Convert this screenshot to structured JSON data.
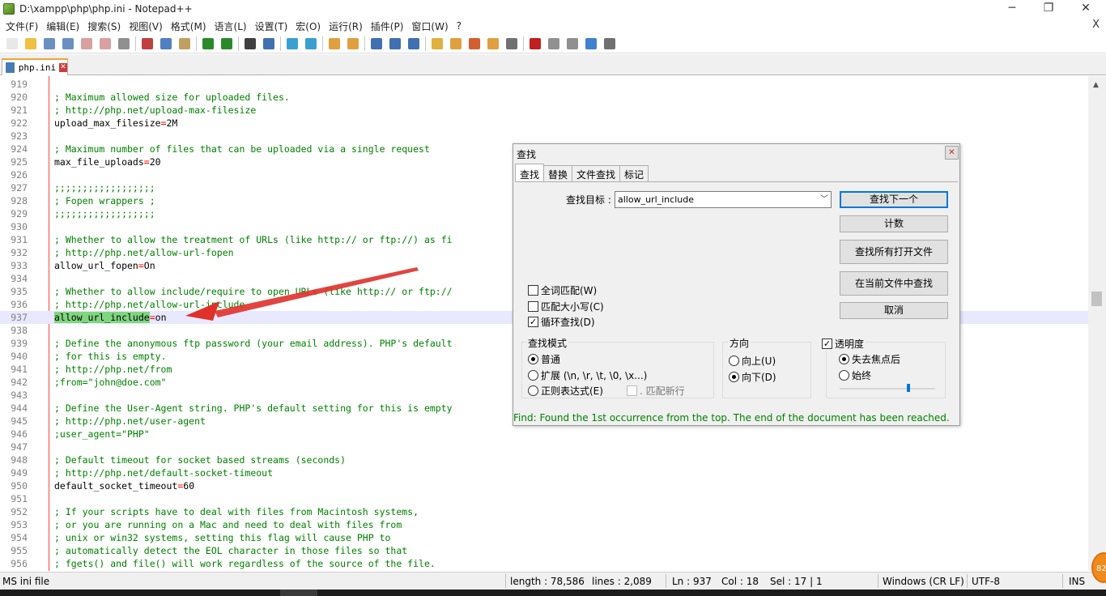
{
  "window": {
    "title": "D:\\xampp\\php\\php.ini - Notepad++",
    "minimize_glyph": "─",
    "maximize_glyph": "❐",
    "close_glyph": "✕",
    "icon": "notepadpp-icon"
  },
  "menu": {
    "items": [
      "文件(F)",
      "编辑(E)",
      "搜索(S)",
      "视图(V)",
      "格式(M)",
      "语言(L)",
      "设置(T)",
      "宏(O)",
      "运行(R)",
      "插件(P)",
      "窗口(W)",
      "?"
    ],
    "close_label": "X"
  },
  "toolbar": {
    "buttons": [
      "new-file-icon",
      "open-file-icon",
      "save-icon",
      "save-all-icon",
      "close-icon",
      "close-all-icon",
      "print-icon",
      "cut-icon",
      "copy-icon",
      "paste-icon",
      "undo-icon",
      "redo-icon",
      "find-icon",
      "replace-icon",
      "zoom-in-icon",
      "zoom-out-icon",
      "sync-v-icon",
      "sync-h-icon",
      "word-wrap-icon",
      "show-all-chars-icon",
      "indent-guide-icon",
      "lang-icon",
      "doc-map-icon",
      "function-list-icon",
      "folder-workspace-icon",
      "monitor-icon",
      "record-macro-icon",
      "stop-macro-icon",
      "play-macro-icon",
      "run-macro-multiple-icon",
      "save-macro-icon"
    ]
  },
  "tabs": [
    {
      "label": "php.ini",
      "close": "✕"
    }
  ],
  "editor": {
    "lines": [
      {
        "n": "919",
        "text": ""
      },
      {
        "n": "920",
        "comment": "; Maximum allowed size for uploaded files."
      },
      {
        "n": "921",
        "comment": "; http://php.net/upload-max-filesize"
      },
      {
        "n": "922",
        "key": "upload_max_filesize",
        "eq": "=",
        "val": "2M"
      },
      {
        "n": "923",
        "text": ""
      },
      {
        "n": "924",
        "comment": "; Maximum number of files that can be uploaded via a single request"
      },
      {
        "n": "925",
        "key": "max_file_uploads",
        "eq": "=",
        "val": "20"
      },
      {
        "n": "926",
        "text": ""
      },
      {
        "n": "927",
        "comment": ";;;;;;;;;;;;;;;;;;"
      },
      {
        "n": "928",
        "comment": "; Fopen wrappers ;"
      },
      {
        "n": "929",
        "comment": ";;;;;;;;;;;;;;;;;;"
      },
      {
        "n": "930",
        "text": ""
      },
      {
        "n": "931",
        "comment": "; Whether to allow the treatment of URLs (like http:// or ftp://) as fi"
      },
      {
        "n": "932",
        "comment": "; http://php.net/allow-url-fopen"
      },
      {
        "n": "933",
        "key": "allow_url_fopen",
        "eq": "=",
        "val": "On"
      },
      {
        "n": "934",
        "text": ""
      },
      {
        "n": "935",
        "comment": "; Whether to allow include/require to open URLs (like http:// or ftp://"
      },
      {
        "n": "936",
        "comment": "; http://php.net/allow-url-include"
      },
      {
        "n": "937",
        "key": "allow_url_include",
        "eq": "=",
        "val": "on",
        "current": true,
        "highlight": true
      },
      {
        "n": "938",
        "text": ""
      },
      {
        "n": "939",
        "comment": "; Define the anonymous ftp password (your email address). PHP's default"
      },
      {
        "n": "940",
        "comment": "; for this is empty."
      },
      {
        "n": "941",
        "comment": "; http://php.net/from"
      },
      {
        "n": "942",
        "comment": ";from=\"john@doe.com\""
      },
      {
        "n": "943",
        "text": ""
      },
      {
        "n": "944",
        "comment": "; Define the User-Agent string. PHP's default setting for this is empty"
      },
      {
        "n": "945",
        "comment": "; http://php.net/user-agent"
      },
      {
        "n": "946",
        "comment": ";user_agent=\"PHP\""
      },
      {
        "n": "947",
        "text": ""
      },
      {
        "n": "948",
        "comment": "; Default timeout for socket based streams (seconds)"
      },
      {
        "n": "949",
        "comment": "; http://php.net/default-socket-timeout"
      },
      {
        "n": "950",
        "key": "default_socket_timeout",
        "eq": "=",
        "val": "60"
      },
      {
        "n": "951",
        "text": ""
      },
      {
        "n": "952",
        "comment": "; If your scripts have to deal with files from Macintosh systems,"
      },
      {
        "n": "953",
        "comment": "; or you are running on a Mac and need to deal with files from"
      },
      {
        "n": "954",
        "comment": "; unix or win32 systems, setting this flag will cause PHP to"
      },
      {
        "n": "955",
        "comment": "; automatically detect the EOL character in those files so that"
      },
      {
        "n": "956",
        "comment": "; fgets() and file() will work regardless of the source of the file."
      }
    ]
  },
  "find_dialog": {
    "title": "查找",
    "close": "✕",
    "tabs": [
      "查找",
      "替换",
      "文件查找",
      "标记"
    ],
    "find_label": "查找目标 :",
    "find_value": "allow_url_include",
    "buttons": {
      "find_next": "查找下一个",
      "count": "计数",
      "find_all_open": "查找所有打开文件",
      "find_all_current": "在当前文件中查找",
      "cancel": "取消"
    },
    "options": {
      "whole_word": "全词匹配(W)",
      "match_case": "匹配大小写(C)",
      "wrap_around": "循环查找(D)"
    },
    "search_mode": {
      "label": "查找模式",
      "normal": "普通",
      "extended": "扩展 (\\n, \\r, \\t, \\0, \\x...)",
      "regex": "正则表达式(E)",
      "dot_newline": ". 匹配新行"
    },
    "direction": {
      "label": "方向",
      "up": "向上(U)",
      "down": "向下(D)"
    },
    "transparency": {
      "label": "透明度",
      "on_lose_focus": "失去焦点后",
      "always": "始终",
      "level": 0.7
    },
    "status": "Find: Found the 1st occurrence from the top. The end of the document has been reached."
  },
  "statusbar": {
    "file_type": "MS ini file",
    "length": "length : 78,586",
    "lines": "lines : 2,089",
    "ln": "Ln : 937",
    "col": "Col : 18",
    "sel": "Sel : 17 | 1",
    "eol": "Windows (CR LF)",
    "encoding": "UTF-8",
    "mode": "INS"
  },
  "badge": {
    "text": "82"
  }
}
